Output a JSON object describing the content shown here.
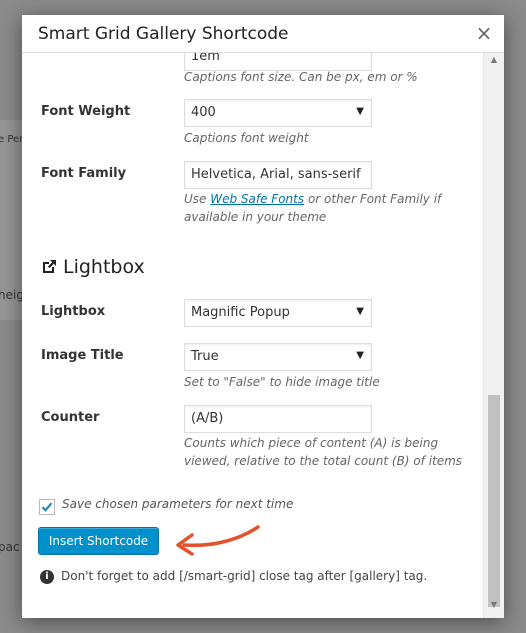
{
  "background": {
    "fragment_1": "e Per",
    "fragment_2": "heig",
    "fragment_3": "pac"
  },
  "modal": {
    "title": "Smart Grid Gallery Shortcode",
    "close_icon": "×"
  },
  "fields": {
    "font_size": {
      "input_value": "1em",
      "description": "Captions font size. Can be px, em or %"
    },
    "font_weight": {
      "label": "Font Weight",
      "selected": "400",
      "description": "Captions font weight"
    },
    "font_family": {
      "label": "Font Family",
      "value": "Helvetica, Arial, sans-serif",
      "desc_prefix": "Use ",
      "desc_link": "Web Safe Fonts",
      "desc_suffix": " or other Font Family if available in your theme"
    }
  },
  "lightbox_section": {
    "heading": "Lightbox",
    "icon": "external-link-icon",
    "lightbox": {
      "label": "Lightbox",
      "selected": "Magnific Popup"
    },
    "image_title": {
      "label": "Image Title",
      "selected": "True",
      "description": "Set to \"False\" to hide image title"
    },
    "counter": {
      "label": "Counter",
      "value": "(A/B)",
      "description": "Counts which piece of content (A) is being viewed, relative to the total count (B) of items"
    }
  },
  "footer": {
    "save_checkbox_checked": true,
    "save_label": "Save chosen parameters for next time",
    "insert_button": "Insert Shortcode",
    "info_icon": "info-icon",
    "info_text": "Don't forget to add [/smart-grid] close tag after [gallery] tag."
  },
  "colors": {
    "button": "#0091cd",
    "link": "#0073aa",
    "annotation_arrow": "#e2522b"
  }
}
